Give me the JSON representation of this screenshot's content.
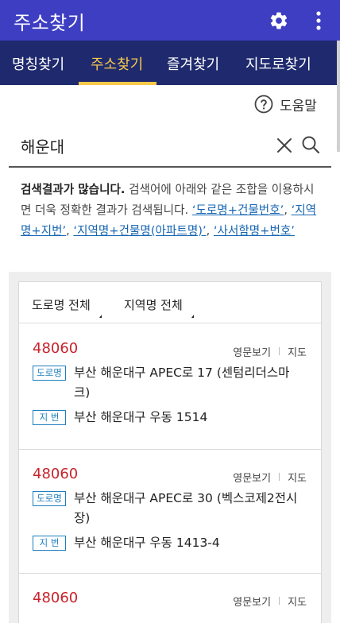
{
  "app_bar": {
    "title": "주소찾기",
    "icons": [
      "gear-icon",
      "more-vert-icon"
    ],
    "color": "#3d3ec2"
  },
  "tabs": [
    {
      "label": "명칭찾기",
      "active": false
    },
    {
      "label": "주소찾기",
      "active": true
    },
    {
      "label": "즐겨찾기",
      "active": false
    },
    {
      "label": "지도로찾기",
      "active": false
    }
  ],
  "tab_colors": {
    "background": "#1f2a6e",
    "active": "#f7c94a"
  },
  "help": {
    "label": "도움말",
    "icon": "question-circle-icon"
  },
  "search": {
    "value": "해운대",
    "icons": [
      "close-icon",
      "search-icon"
    ]
  },
  "notice": {
    "bold": "검색결과가 많습니다.",
    "text": "검색어에 아래와 같은 조합을 이용하시면 더욱 정확한 결과가 검색됩니다.",
    "examples": [
      "‘도로명+건물번호’",
      "‘지역명+지번’",
      "‘지역명+건물명(아파트명)’",
      "‘사서함명+번호’"
    ],
    "separator": ","
  },
  "filters": {
    "road": "도로명 전체",
    "region": "지역명 전체"
  },
  "results": [
    {
      "zip": "48060",
      "eng_link": "영문보기",
      "map_link": "지도",
      "road_badge": "도로명",
      "road_addr": "부산 해운대구 APEC로 17 (센텀리더스마크)",
      "jibun_badge": "지 번",
      "jibun_addr": "부산 해운대구 우동 1514"
    },
    {
      "zip": "48060",
      "eng_link": "영문보기",
      "map_link": "지도",
      "road_badge": "도로명",
      "road_addr": "부산 해운대구 APEC로 30 (벡스코제2전시장)",
      "jibun_badge": "지 번",
      "jibun_addr": "부산 해운대구 우동 1413-4"
    },
    {
      "zip": "48060",
      "eng_link": "영문보기",
      "map_link": "지도"
    }
  ],
  "colors": {
    "zip": "#c8232c",
    "badge": "#1f7fbf",
    "link": "#1766b3"
  }
}
